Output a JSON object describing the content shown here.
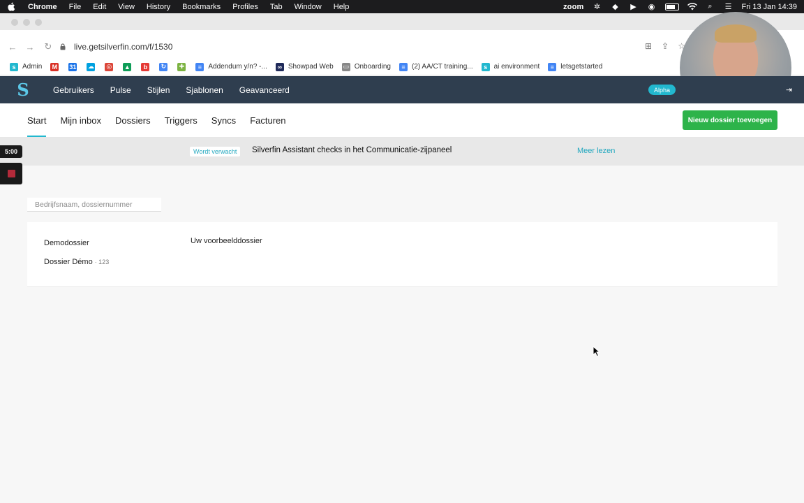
{
  "mac_menubar": {
    "items": [
      "Chrome",
      "File",
      "Edit",
      "View",
      "History",
      "Bookmarks",
      "Profiles",
      "Tab",
      "Window",
      "Help"
    ],
    "zoom_label": "zoom",
    "clock": "Fri 13 Jan  14:39"
  },
  "browser": {
    "url": "live.getsilverfin.com/f/1530",
    "bookmarks": [
      {
        "label": "Admin",
        "icon": "silverfin-icon",
        "color": "#22b8cf"
      },
      {
        "label": "",
        "icon": "gmail-icon",
        "color": "#d93025"
      },
      {
        "label": "",
        "icon": "calendar-icon",
        "color": "#1a73e8"
      },
      {
        "label": "",
        "icon": "salesforce-icon",
        "color": "#00a1e0"
      },
      {
        "label": "",
        "icon": "chrome-icon",
        "color": "#db4437"
      },
      {
        "label": "",
        "icon": "drive-icon",
        "color": "#0f9d58"
      },
      {
        "label": "",
        "icon": "b-icon",
        "color": "#e53935"
      },
      {
        "label": "",
        "icon": "refresh-icon",
        "color": "#4285f4"
      },
      {
        "label": "",
        "icon": "plus-icon",
        "color": "#7cb342"
      },
      {
        "label": "Addendum y/n? -...",
        "icon": "doc-icon",
        "color": "#4285f4"
      },
      {
        "label": "Showpad Web",
        "icon": "showpad-icon",
        "color": "#1f2a5a"
      },
      {
        "label": "Onboarding",
        "icon": "folder-icon",
        "color": "#888888"
      },
      {
        "label": "(2) AA/CT training...",
        "icon": "doc-icon",
        "color": "#4285f4"
      },
      {
        "label": "ai environment",
        "icon": "silverfin-icon",
        "color": "#22b8cf"
      },
      {
        "label": "letsgetstarted",
        "icon": "doc-icon",
        "color": "#4285f4"
      }
    ]
  },
  "app_nav": {
    "links": [
      "Gebruikers",
      "Pulse",
      "Stijlen",
      "Sjablonen",
      "Geavanceerd"
    ],
    "alpha_badge": "Alpha"
  },
  "sub_nav": {
    "tabs": [
      "Start",
      "Mijn inbox",
      "Dossiers",
      "Triggers",
      "Syncs",
      "Facturen"
    ],
    "active_tab": "Start",
    "new_dossier_button": "Nieuw dossier toevoegen"
  },
  "announcement": {
    "badge": "Wordt verwacht",
    "message": "Silverfin Assistant checks in het Communicatie-zijpaneel",
    "link": "Meer lezen"
  },
  "recording": {
    "time": "5:00"
  },
  "search": {
    "placeholder": "Bedrijfsnaam, dossiernummer"
  },
  "dossiers": {
    "group_label": "Demodossier",
    "group_description": "Uw voorbeelddossier",
    "items": [
      {
        "name": "Dossier Démo",
        "number": "· 123"
      }
    ]
  },
  "colors": {
    "navbar": "#2f3e4f",
    "accent": "#22b8cf",
    "primary_button": "#2db34a"
  }
}
